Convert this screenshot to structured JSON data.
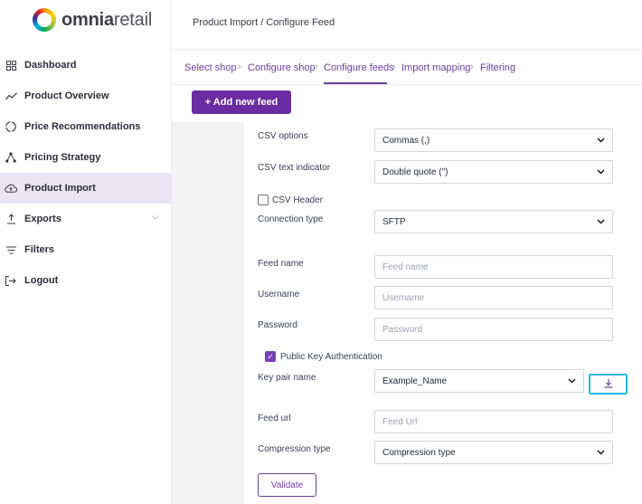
{
  "brand": {
    "name_bold": "omnia",
    "name_light": "retail"
  },
  "sidebar": {
    "items": [
      {
        "label": "Dashboard",
        "icon": "grid-icon"
      },
      {
        "label": "Product Overview",
        "icon": "trend-line-icon"
      },
      {
        "label": "Price Recommendations",
        "icon": "circle-icon"
      },
      {
        "label": "Pricing Strategy",
        "icon": "network-icon"
      },
      {
        "label": "Product Import",
        "icon": "cloud-upload-icon",
        "active": true
      },
      {
        "label": "Exports",
        "icon": "upload-icon",
        "has_submenu": true
      },
      {
        "label": "Filters",
        "icon": "filter-icon"
      },
      {
        "label": "Logout",
        "icon": "logout-icon"
      }
    ]
  },
  "header": {
    "breadcrumb": "Product Import / Configure Feed"
  },
  "steps": [
    "Select shop",
    "Configure shop",
    "Configure feeds",
    "Import mapping",
    "Filtering"
  ],
  "add_feed_label": "+ Add new feed",
  "form": {
    "csv_options": {
      "label": "CSV options",
      "value": "Commas (,)"
    },
    "csv_text_indicator": {
      "label": "CSV text indicator",
      "value": "Double quote (\")"
    },
    "csv_header": {
      "label": "CSV Header",
      "checked": false
    },
    "connection_type": {
      "label": "Connection type",
      "value": "SFTP"
    },
    "feed_name": {
      "label": "Feed name",
      "placeholder": "Feed name"
    },
    "username": {
      "label": "Username",
      "placeholder": "Username"
    },
    "password": {
      "label": "Password",
      "placeholder": "Password"
    },
    "public_key_auth": {
      "label": "Public Key Authentication",
      "checked": true
    },
    "key_pair_name": {
      "label": "Key pair name",
      "value": "Example_Name"
    },
    "feed_url": {
      "label": "Feed url",
      "placeholder": "Feed Url"
    },
    "compression_type": {
      "label": "Compression type",
      "value": "Compression type"
    },
    "validate_label": "Validate"
  },
  "colors": {
    "accent": "#6b2ba1",
    "active_bg": "#ebe4f5",
    "highlight": "#2ab7e6"
  }
}
